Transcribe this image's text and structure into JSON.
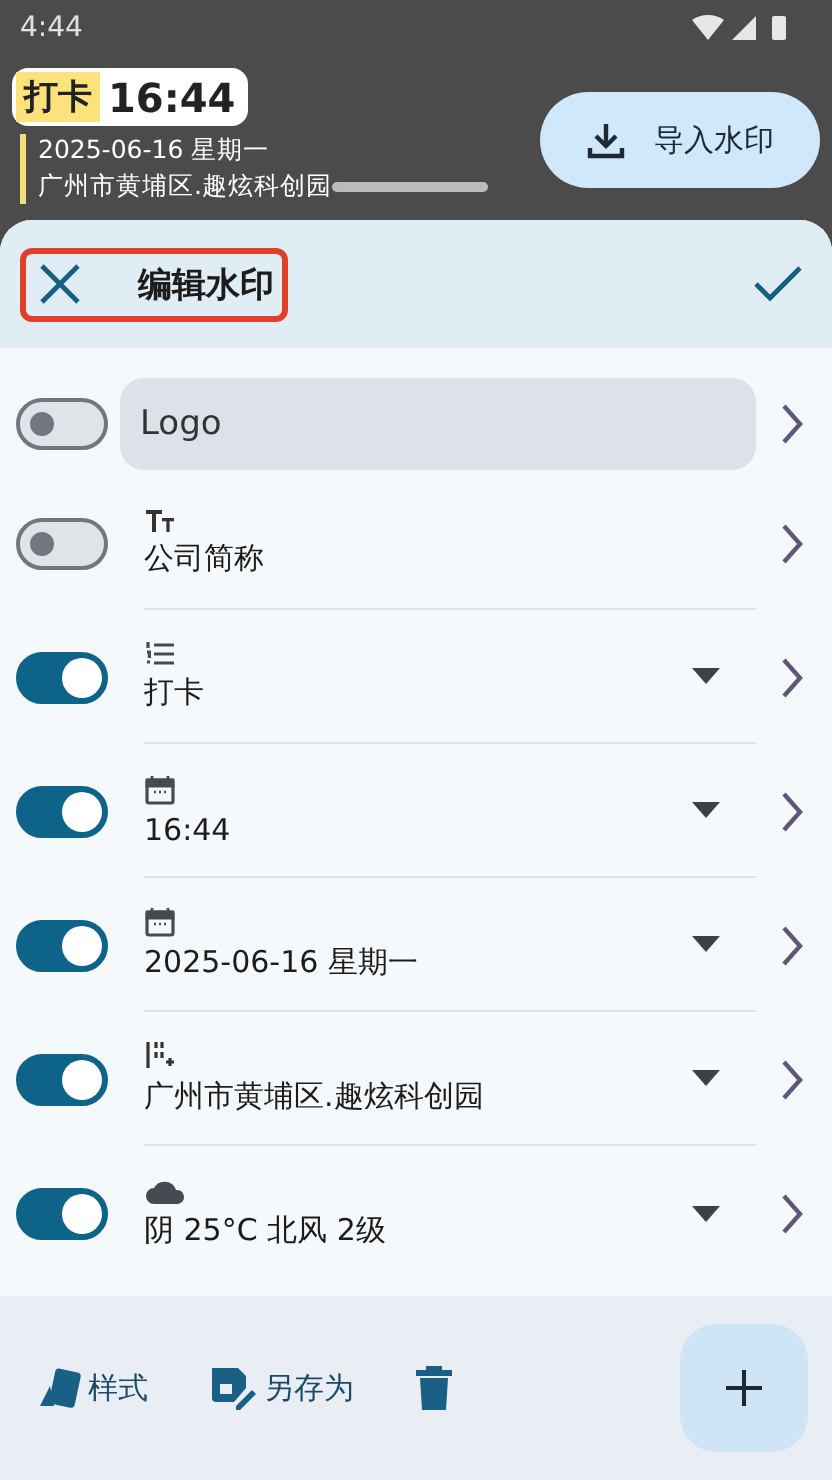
{
  "status_bar": {
    "time": "4:44"
  },
  "preview": {
    "tag": "打卡",
    "time": "16:44",
    "lines": [
      "2025-06-16 星期一",
      "广州市黄埔区.趣炫科创园"
    ]
  },
  "import_button": {
    "label": "导入水印"
  },
  "sheet": {
    "title": "编辑水印"
  },
  "items": [
    {
      "kind": "logo",
      "label": "Logo",
      "on": false,
      "dropdown": false
    },
    {
      "kind": "text",
      "label": "公司简称",
      "on": false,
      "dropdown": false
    },
    {
      "kind": "list",
      "label": "打卡",
      "on": true,
      "dropdown": true
    },
    {
      "kind": "time",
      "label": "16:44",
      "on": true,
      "dropdown": true
    },
    {
      "kind": "date",
      "label": "2025-06-16 星期一",
      "on": true,
      "dropdown": true
    },
    {
      "kind": "location",
      "label": "广州市黄埔区.趣炫科创园",
      "on": true,
      "dropdown": true
    },
    {
      "kind": "weather",
      "label": "阴 25°C 北风 2级",
      "on": true,
      "dropdown": true
    }
  ],
  "bottom_bar": [
    {
      "kind": "style",
      "label": "样式"
    },
    {
      "kind": "save",
      "label": "另存为"
    },
    {
      "kind": "delete"
    }
  ]
}
